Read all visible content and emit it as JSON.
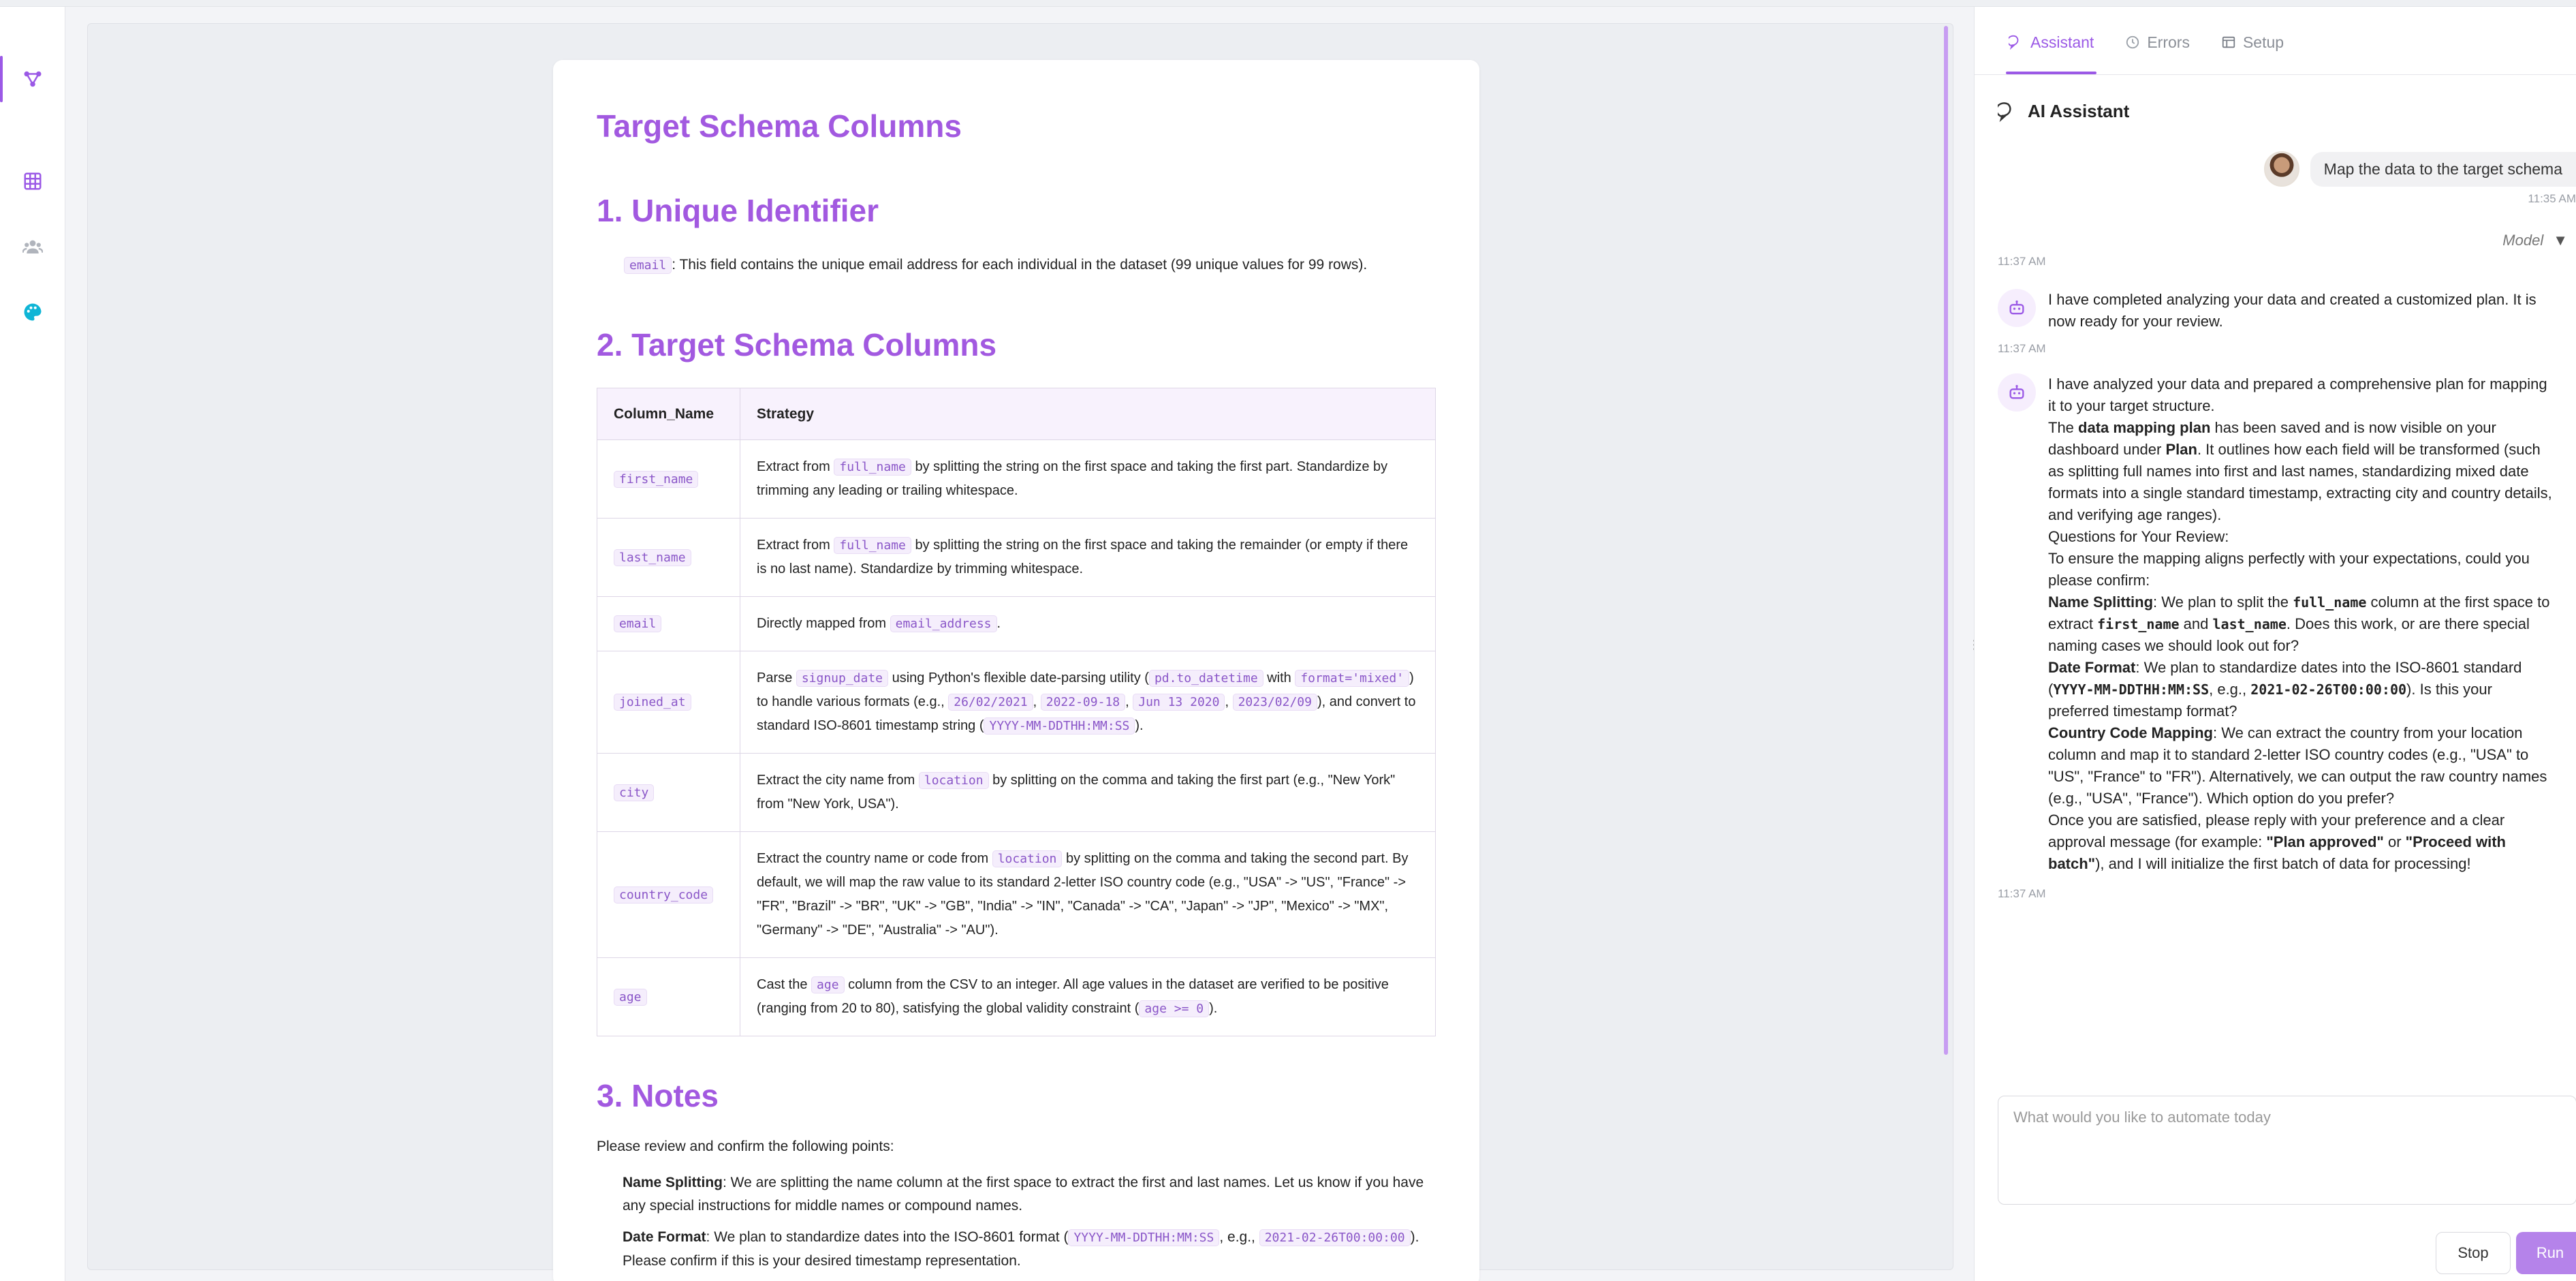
{
  "document": {
    "title": "Target Schema Columns",
    "unique_section": {
      "heading": "1. Unique Identifier",
      "field": "email",
      "text": ": This field contains the unique email address for each individual in the dataset (99 unique values for 99 rows)."
    },
    "schema_section": {
      "heading": "2. Target Schema Columns",
      "headers": [
        "Column_Name",
        "Strategy"
      ],
      "rows": [
        {
          "column": "first_name",
          "strategy": [
            {
              "t": "Extract from "
            },
            {
              "c": "full_name"
            },
            {
              "t": " by splitting the string on the first space and taking the first part. Standardize by trimming any leading or trailing whitespace."
            }
          ]
        },
        {
          "column": "last_name",
          "strategy": [
            {
              "t": "Extract from "
            },
            {
              "c": "full_name"
            },
            {
              "t": " by splitting the string on the first space and taking the remainder (or empty if there is no last name). Standardize by trimming whitespace."
            }
          ]
        },
        {
          "column": "email",
          "strategy": [
            {
              "t": "Directly mapped from "
            },
            {
              "c": "email_address"
            },
            {
              "t": "."
            }
          ]
        },
        {
          "column": "joined_at",
          "strategy": [
            {
              "t": "Parse "
            },
            {
              "c": "signup_date"
            },
            {
              "t": " using Python's flexible date-parsing utility ("
            },
            {
              "c": "pd.to_datetime"
            },
            {
              "t": " with "
            },
            {
              "c": "format='mixed'"
            },
            {
              "t": ") to handle various formats (e.g., "
            },
            {
              "c": "26/02/2021"
            },
            {
              "t": ", "
            },
            {
              "c": "2022-09-18"
            },
            {
              "t": ", "
            },
            {
              "c": "Jun 13 2020"
            },
            {
              "t": ", "
            },
            {
              "c": "2023/02/09"
            },
            {
              "t": "), and convert to standard ISO-8601 timestamp string ("
            },
            {
              "c": "YYYY-MM-DDTHH:MM:SS"
            },
            {
              "t": ")."
            }
          ]
        },
        {
          "column": "city",
          "strategy": [
            {
              "t": "Extract the city name from "
            },
            {
              "c": "location"
            },
            {
              "t": " by splitting on the comma and taking the first part (e.g., \"New York\" from \"New York, USA\")."
            }
          ]
        },
        {
          "column": "country_code",
          "strategy": [
            {
              "t": "Extract the country name or code from "
            },
            {
              "c": "location"
            },
            {
              "t": " by splitting on the comma and taking the second part. By default, we will map the raw value to its standard 2-letter ISO country code (e.g., \"USA\" -> \"US\", \"France\" -> \"FR\", \"Brazil\" -> \"BR\", \"UK\" -> \"GB\", \"India\" -> \"IN\", \"Canada\" -> \"CA\", \"Japan\" -> \"JP\", \"Mexico\" -> \"MX\", \"Germany\" -> \"DE\", \"Australia\" -> \"AU\")."
            }
          ]
        },
        {
          "column": "age",
          "strategy": [
            {
              "t": "Cast the "
            },
            {
              "c": "age"
            },
            {
              "t": " column from the CSV to an integer. All age values in the dataset are verified to be positive (ranging from 20 to 80), satisfying the global validity constraint ("
            },
            {
              "c": "age >= 0"
            },
            {
              "t": ")."
            }
          ]
        }
      ]
    },
    "notes_section": {
      "heading": "3. Notes",
      "intro": "Please review and confirm the following points:",
      "items": [
        [
          {
            "b": "Name Splitting"
          },
          {
            "t": ": We are splitting the name column at the first space to extract the first and last names. Let us know if you have any special instructions for middle names or compound names."
          }
        ],
        [
          {
            "b": "Date Format"
          },
          {
            "t": ": We plan to standardize dates into the ISO-8601 format ("
          },
          {
            "c": "YYYY-MM-DDTHH:MM:SS"
          },
          {
            "t": ", e.g., "
          },
          {
            "c": "2021-02-26T00:00:00"
          },
          {
            "t": "). Please confirm if this is your desired timestamp representation."
          }
        ]
      ]
    }
  },
  "panel": {
    "tabs": [
      {
        "label": "Assistant",
        "icon": "chat-icon",
        "active": true
      },
      {
        "label": "Errors",
        "icon": "clock-icon",
        "active": false
      },
      {
        "label": "Setup",
        "icon": "table-icon",
        "active": false
      }
    ],
    "header": "AI Assistant",
    "user_message": "Map the data to the target schema",
    "user_time": "11:35 AM",
    "model_label": "Model",
    "time_1": "11:37 AM",
    "bot_message_1": "I have completed analyzing your data and created a customized plan. It is now ready for your review.",
    "time_2": "11:37 AM",
    "bot_message_2": [
      [
        {
          "t": "I have analyzed your data and prepared a comprehensive plan for mapping it to your target structure."
        }
      ],
      [
        {
          "t": "The "
        },
        {
          "b": "data mapping plan"
        },
        {
          "t": " has been saved and is now visible on your dashboard under "
        },
        {
          "b": "Plan"
        },
        {
          "t": ". It outlines how each field will be transformed (such as splitting full names into first and last names, standardizing mixed date formats into a single standard timestamp, extracting city and country details, and verifying age ranges)."
        }
      ],
      [
        {
          "t": "Questions for Your Review:"
        }
      ],
      [
        {
          "t": "To ensure the mapping aligns perfectly with your expectations, could you please confirm:"
        }
      ],
      [
        {
          "b": "Name Splitting"
        },
        {
          "t": ": We plan to split the "
        },
        {
          "m": "full_name"
        },
        {
          "t": " column at the first space to extract "
        },
        {
          "m": "first_name"
        },
        {
          "t": " and "
        },
        {
          "m": "last_name"
        },
        {
          "t": ". Does this work, or are there special naming cases we should look out for?"
        }
      ],
      [
        {
          "b": "Date Format"
        },
        {
          "t": ": We plan to standardize dates into the ISO-8601 standard ("
        },
        {
          "m": "YYYY-MM-DDTHH:MM:SS"
        },
        {
          "t": ", e.g., "
        },
        {
          "m": "2021-02-26T00:00:00"
        },
        {
          "t": "). Is this your preferred timestamp format?"
        }
      ],
      [
        {
          "b": "Country Code Mapping"
        },
        {
          "t": ": We can extract the country from your location column and map it to standard 2-letter ISO country codes (e.g., \"USA\" to \"US\", \"France\" to \"FR\"). Alternatively, we can output the raw country names (e.g., \"USA\", \"France\"). Which option do you prefer?"
        }
      ],
      [
        {
          "t": "Once you are satisfied, please reply with your preference and a clear approval message (for example: "
        },
        {
          "b": "\"Plan approved\""
        },
        {
          "t": " or "
        },
        {
          "b": "\"Proceed with batch\""
        },
        {
          "t": "), and I will initialize the first batch of data for processing!"
        }
      ]
    ],
    "time_3": "11:37 AM",
    "input_placeholder": "What would you like to automate today",
    "stop_label": "Stop",
    "run_label": "Run"
  },
  "colors": {
    "accent": "#9b59e6",
    "heading": "#a259e0",
    "code": "#8a56c8"
  }
}
